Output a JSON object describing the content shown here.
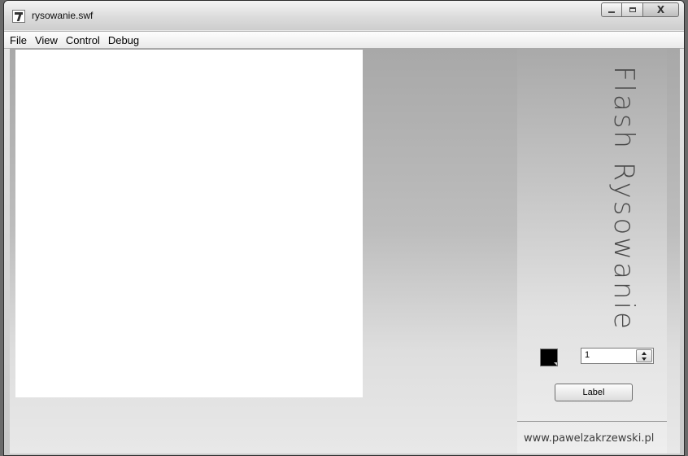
{
  "window": {
    "title": "rysowanie.swf",
    "close_glyph": "X"
  },
  "menu": {
    "items": [
      "File",
      "View",
      "Control",
      "Debug"
    ]
  },
  "panel": {
    "brand_title": "Flash Rysowanie",
    "color_swatch_value": "#000000",
    "stepper_value": "1",
    "button_label": "Label",
    "url": "www.pawelzakrzewski.pl"
  },
  "icons": {
    "app": "flash-app-icon",
    "minimize": "minimize-icon",
    "maximize": "maximize-icon",
    "close": "close-icon",
    "stepper_up": "arrow-up-icon",
    "stepper_down": "arrow-down-icon"
  }
}
